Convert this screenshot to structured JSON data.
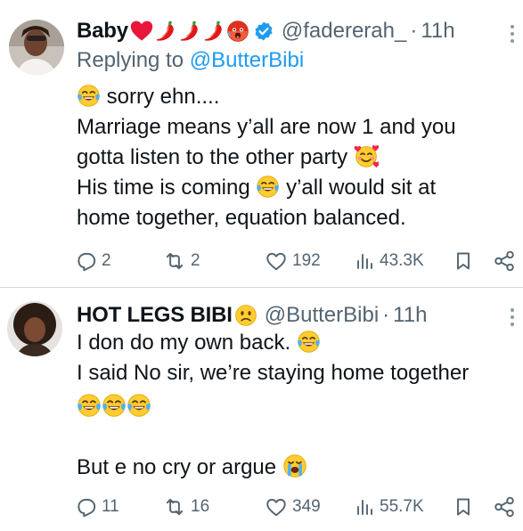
{
  "colors": {
    "text": "#0f1419",
    "secondary": "#536471",
    "link": "#1d9bf0",
    "verified": "#1d9bf0",
    "divider": "#cfd9de"
  },
  "tweets": [
    {
      "name": "Baby",
      "name_emojis": [
        "red-heart",
        "chili-pepper",
        "chili-pepper",
        "chili-pepper",
        "hot-face"
      ],
      "verified": true,
      "handle": "@fadererah_",
      "separator": "·",
      "time": "11h",
      "reply_prefix": "Replying to",
      "reply_to": "@ButterBibi",
      "body_lines": [
        {
          "text": "sorry ehn....",
          "emoji_before": "tears-of-joy"
        },
        {
          "text": "Marriage means y’all are now 1 and you"
        },
        {
          "text": "gotta listen to the other party",
          "emoji_after": "smiling-face-with-hearts"
        },
        {
          "text": "His time is coming",
          "emoji_mid": "tears-of-joy",
          "text2": "y’all would sit at"
        },
        {
          "text": "home together, equation balanced."
        }
      ],
      "actions": {
        "replies": "2",
        "retweets": "2",
        "likes": "192",
        "views": "43.3K"
      }
    },
    {
      "name": "HOT LEGS BIBI",
      "name_emojis": [
        "frowning-face"
      ],
      "verified": false,
      "handle": "@ButterBibi",
      "separator": "·",
      "time": "11h",
      "body_lines": [
        {
          "text": "I don do my own back.",
          "emoji_after": "tears-of-joy"
        },
        {
          "text": "I said No sir, we’re staying home together"
        },
        {
          "text": "",
          "emojis": [
            "tears-of-joy",
            "tears-of-joy",
            "tears-of-joy"
          ]
        },
        {
          "text": ""
        },
        {
          "text": "But e no cry or argue",
          "emoji_after": "loudly-crying-face"
        }
      ],
      "actions": {
        "replies": "11",
        "retweets": "16",
        "likes": "349",
        "views": "55.7K"
      }
    }
  ]
}
